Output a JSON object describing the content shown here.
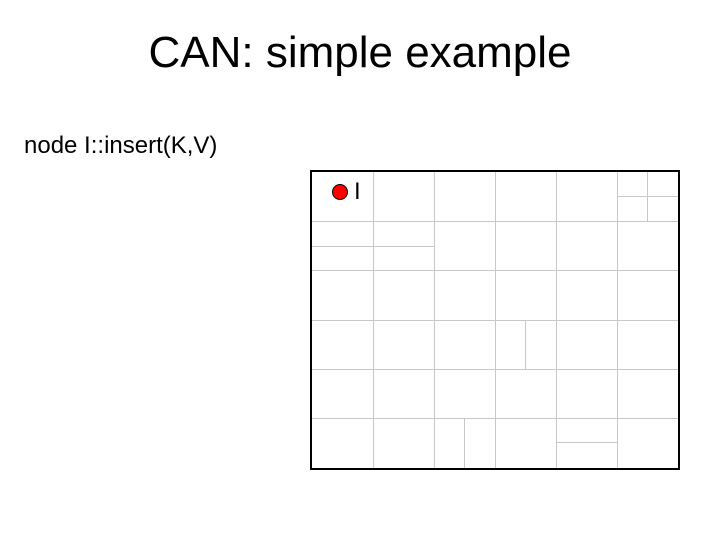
{
  "title": "CAN: simple example",
  "caption": "node I::insert(K,V)",
  "node": {
    "label": "I",
    "color": "#ff0000"
  }
}
